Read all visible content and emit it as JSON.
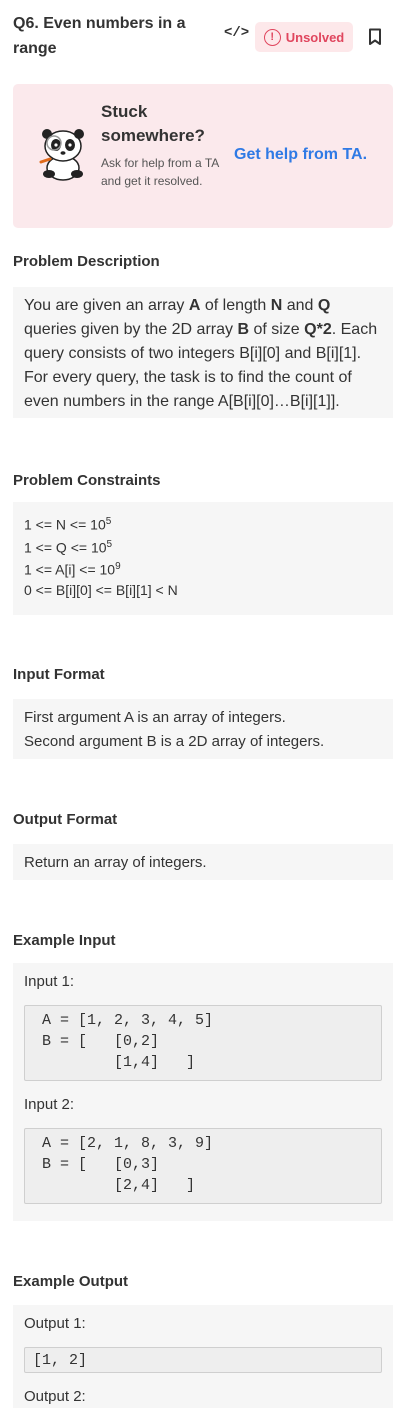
{
  "problem": {
    "title": "Q6. Even numbers in a range"
  },
  "toolbar": {
    "code_label": "</>",
    "status_label": "Unsolved",
    "status_mark": "!",
    "status_color": "#e0465e"
  },
  "help": {
    "title": "Stuck somewhere?",
    "subtitle": "Ask for help from a TA and get it resolved.",
    "link": "Get help from TA.",
    "link_color": "#2f7ae5"
  },
  "description": {
    "heading": "Problem Description",
    "parts": [
      "You are given an array ",
      "A",
      " of length ",
      "N",
      " and ",
      "Q",
      " queries given by the 2D array ",
      "B",
      " of size ",
      "Q*2",
      ". Each query consists of two integers B[i][0] and B[i][1]. For every query, the task is to find the count of even numbers in the range A[B[i][0]…B[i][1]]."
    ]
  },
  "constraints": {
    "heading": "Problem Constraints",
    "lines": [
      {
        "pre": "1 <= N <= 10",
        "sup": "5",
        "post": ""
      },
      {
        "pre": "1 <= Q <= 10",
        "sup": "5",
        "post": ""
      },
      {
        "pre": "1 <= A[i] <= 10",
        "sup": "9",
        "post": ""
      },
      {
        "pre": "0 <= B[i][0] <= B[i][1] < N",
        "sup": "",
        "post": ""
      }
    ]
  },
  "input_format": {
    "heading": "Input Format",
    "lines": [
      "First argument A is an array of integers.",
      "Second argument B is a 2D array of integers."
    ]
  },
  "output_format": {
    "heading": "Output Format",
    "text": "Return an array of integers."
  },
  "example_input": {
    "heading": "Example Input",
    "items": [
      {
        "label": "Input 1:",
        "code": " A = [1, 2, 3, 4, 5]\n B = [   [0,2]\n         [1,4]   ]"
      },
      {
        "label": "Input 2:",
        "code": " A = [2, 1, 8, 3, 9]\n B = [   [0,3]\n         [2,4]   ]"
      }
    ]
  },
  "example_output": {
    "heading": "Example Output",
    "items": [
      {
        "label": "Output 1:",
        "code": "[1, 2]"
      },
      {
        "label": "Output 2:",
        "code": ""
      }
    ]
  }
}
